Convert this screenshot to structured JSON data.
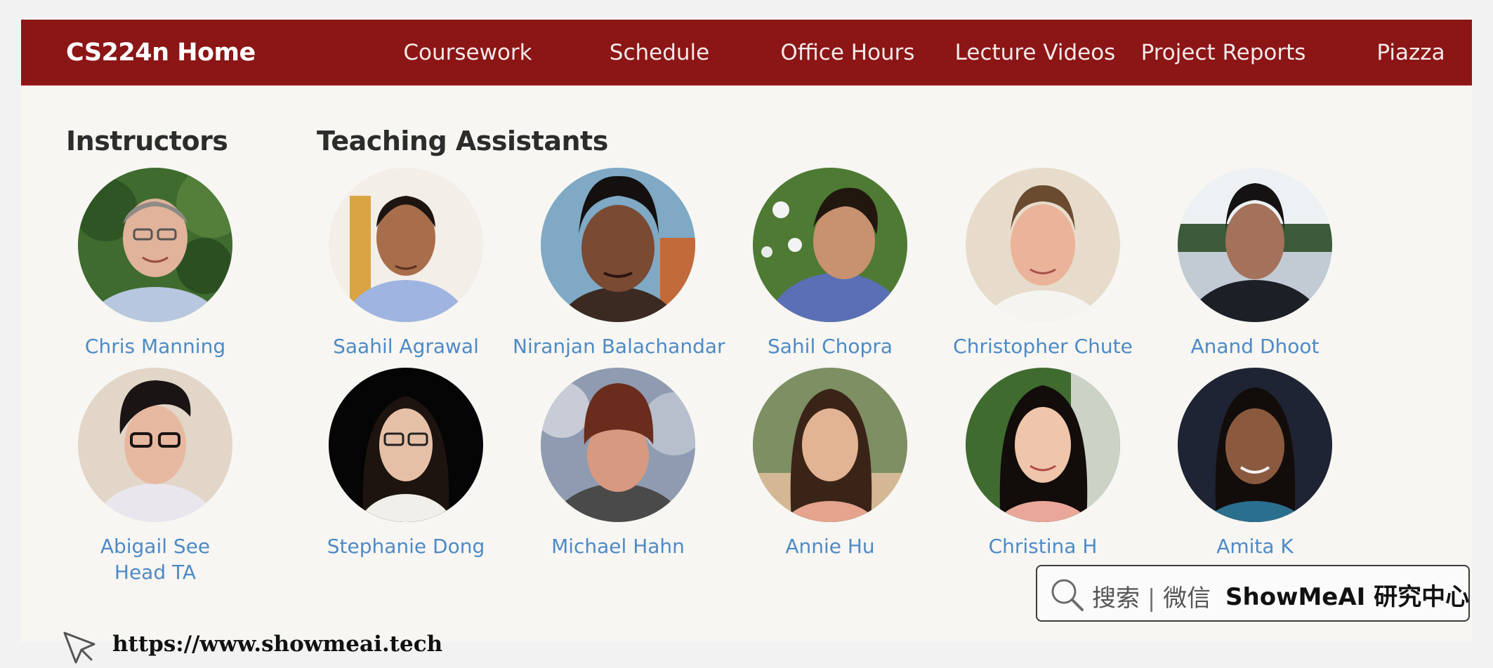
{
  "nav": {
    "brand": "CS224n Home",
    "links": [
      "Coursework",
      "Schedule",
      "Office Hours",
      "Lecture Videos",
      "Project Reports",
      "Piazza"
    ]
  },
  "sections": {
    "instructors": "Instructors",
    "tas": "Teaching Assistants"
  },
  "people": [
    {
      "name": "Chris Manning",
      "role": ""
    },
    {
      "name": "Saahil Agrawal",
      "role": ""
    },
    {
      "name": "Niranjan Balachandar",
      "role": ""
    },
    {
      "name": "Sahil Chopra",
      "role": ""
    },
    {
      "name": "Christopher Chute",
      "role": ""
    },
    {
      "name": "Anand Dhoot",
      "role": ""
    },
    {
      "name": "Abigail See",
      "role": "Head TA"
    },
    {
      "name": "Stephanie Dong",
      "role": ""
    },
    {
      "name": "Michael Hahn",
      "role": ""
    },
    {
      "name": "Annie Hu",
      "role": ""
    },
    {
      "name": "Christina H",
      "role": ""
    },
    {
      "name": "Amita K",
      "role": ""
    }
  ],
  "watermark": {
    "search_prefix": "搜索",
    "separator": "|",
    "search_channel": "微信",
    "brand": "ShowMeAI 研究中心",
    "url": "https://www.showmeai.tech"
  },
  "colors": {
    "navbar": "#8c1515",
    "link": "#4e8ac6",
    "heading": "#2c2c2c",
    "page_bg": "#f7f6f2"
  },
  "icons": {
    "search": "search-icon",
    "cursor": "cursor-icon"
  }
}
